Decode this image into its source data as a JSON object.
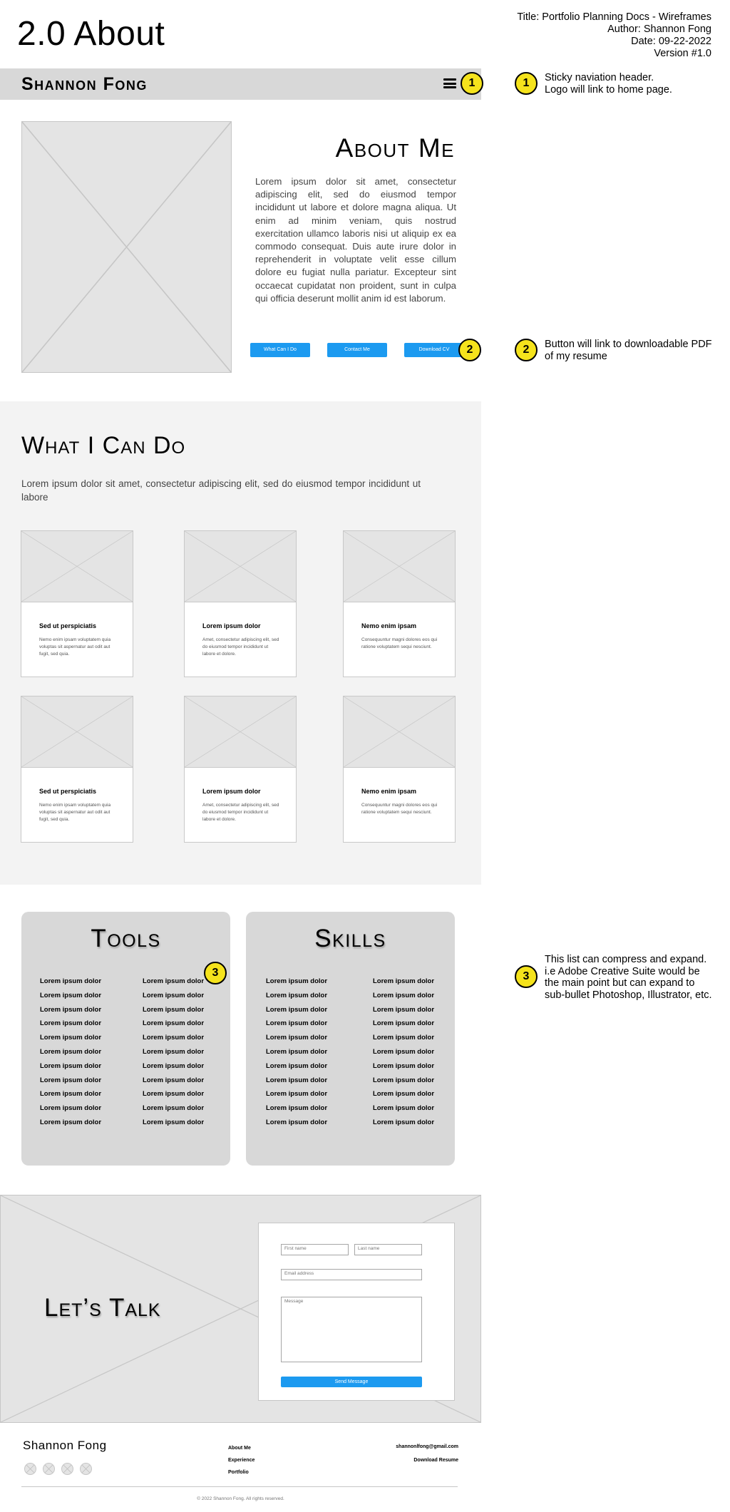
{
  "doc": {
    "title": "2.0 About",
    "meta": [
      "Title: Portfolio Planning Docs - Wireframes",
      "Author: Shannon Fong",
      "Date: 09-22-2022",
      "Version #1.0"
    ]
  },
  "nav": {
    "brand": "Shannon Fong",
    "menu_icon": "hamburger-icon"
  },
  "annotations": [
    {
      "num": "1",
      "text_line1": "Sticky naviation header.",
      "text_line2": "Logo will link to home page."
    },
    {
      "num": "2",
      "text_line1": "Button will link to downloadable PDF",
      "text_line2": "of my resume"
    },
    {
      "num": "3",
      "text_line1": "This list can compress and expand.",
      "text_line2": "i.e Adobe Creative Suite would be",
      "text_line3": "the main point but can expand to",
      "text_line4": "sub-bullet Photoshop, Illustrator, etc."
    }
  ],
  "about": {
    "heading": "About Me",
    "body": "Lorem ipsum dolor sit amet, consectetur adipiscing elit, sed do eiusmod tempor incididunt ut labore et dolore magna aliqua. Ut enim ad minim veniam, quis nostrud exercitation ullamco laboris nisi ut aliquip ex ea commodo consequat. Duis aute irure dolor in reprehenderit in voluptate velit esse cillum dolore eu fugiat nulla pariatur. Excepteur sint occaecat cupidatat non proident, sunt in culpa qui officia deserunt mollit anim id est laborum.",
    "buttons": [
      "What Can I Do",
      "Contact Me",
      "Download CV"
    ]
  },
  "what_i_can_do": {
    "heading": "What I Can Do",
    "intro": "Lorem ipsum dolor sit amet, consectetur adipiscing elit, sed do eiusmod tempor incididunt ut labore",
    "cards": [
      {
        "title": "Sed ut perspiciatis",
        "desc": "Nemo enim ipsam voluptatem quia voluptas sit aspernatur aut odit aut fugit, sed quia."
      },
      {
        "title": "Lorem ipsum dolor",
        "desc": "Amet, consectetur adipiscing elit, sed do eiusmod tempor incididunt ut labore et dolore."
      },
      {
        "title": "Nemo enim ipsam",
        "desc": "Consequuntur magni dolores eos qui ratione voluptatem sequi nesciunt."
      },
      {
        "title": "Sed ut perspiciatis",
        "desc": "Nemo enim ipsam voluptatem quia voluptas sit aspernatur aut odit aut fugit, sed quia."
      },
      {
        "title": "Lorem ipsum dolor",
        "desc": "Amet, consectetur adipiscing elit, sed do eiusmod tempor incididunt ut labore et dolore."
      },
      {
        "title": "Nemo enim ipsam",
        "desc": "Consequuntur magni dolores eos qui ratione voluptatem sequi nesciunt."
      }
    ]
  },
  "tools": {
    "heading": "Tools",
    "item": "Lorem ipsum dolor"
  },
  "skills": {
    "heading": "Skills",
    "item": "Lorem ipsum dolor"
  },
  "talk": {
    "heading": "Let’s Talk",
    "first_name": "First name",
    "last_name": "Last name",
    "email": "Email address",
    "message": "Message",
    "submit": "Send Message"
  },
  "footer": {
    "brand": "Shannon Fong",
    "links": [
      "About Me",
      "Experience",
      "Portfolio"
    ],
    "email": "shannonlfong@gmail.com",
    "resume": "Download Resume",
    "copyright": "© 2022 Shannon Fong. All rights reserved."
  },
  "colors": {
    "accent": "#1c9af0",
    "badge": "#f5e31c",
    "nav": "#d8d8d8",
    "section_bg": "#f3f3f3",
    "placeholder": "#e4e4e4"
  }
}
